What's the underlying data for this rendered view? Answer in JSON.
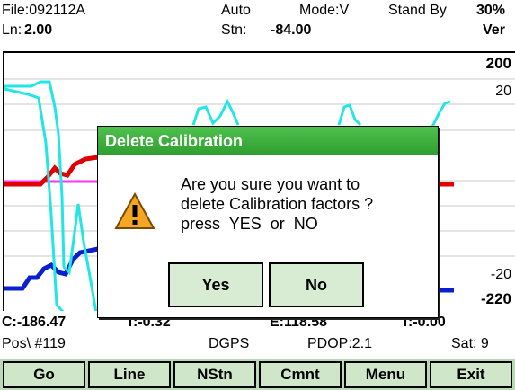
{
  "header": {
    "file": "File:092112A",
    "mode_auto": "Auto",
    "mode": "Mode:V",
    "status": "Stand By",
    "battery": "30%",
    "ln_label": "Ln:",
    "ln_value": "2.00",
    "stn_label": "Stn:",
    "stn_value": "-84.00",
    "view": "Ver"
  },
  "plot": {
    "labels": {
      "top_bold": "200",
      "top": "20",
      "bottom": "-20",
      "bottom_bold": "-220"
    },
    "colors": {
      "cyan": "#22e5e5",
      "red": "#e00000",
      "magenta": "#ff33ff",
      "blue": "#0a1fd0",
      "gridline": "#c8c8c8"
    }
  },
  "readouts": {
    "c": "C:-186.47",
    "t": "T:-0.32",
    "e": "E:118.58",
    "t2": "T:-0.00",
    "pos": "Pos\\ #119",
    "gps": "DGPS",
    "pdop": "PDOP:2.1",
    "sat": "Sat: 9"
  },
  "softkeys": [
    "Go",
    "Line",
    "NStn",
    "Cmnt",
    "Menu",
    "Exit"
  ],
  "dialog": {
    "title": "Delete Calibration",
    "icon": "warning-icon",
    "lines": [
      "Are you sure you want to",
      "delete Calibration factors ?",
      "press  YES  or  NO"
    ],
    "yes": "Yes",
    "no": "No"
  }
}
